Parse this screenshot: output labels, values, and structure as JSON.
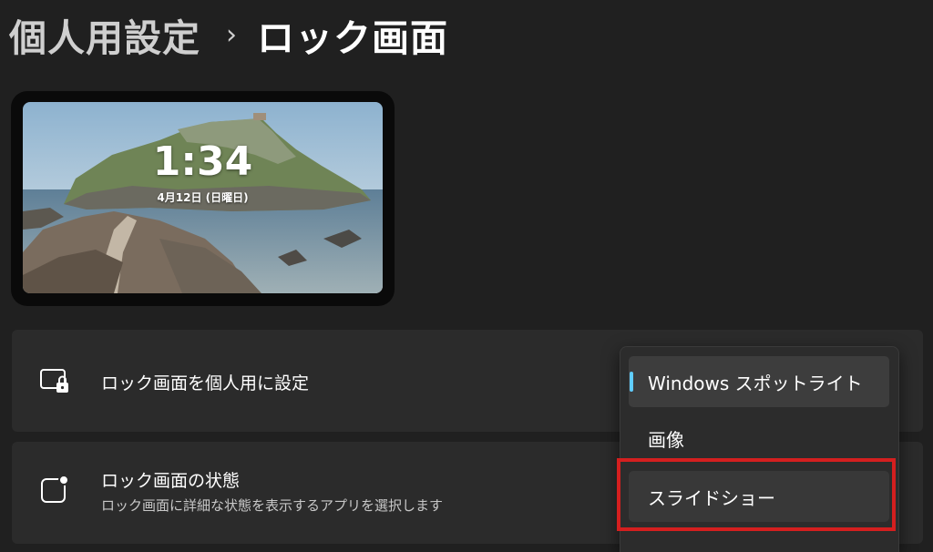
{
  "breadcrumb": {
    "parent": "個人用設定",
    "separator": "›",
    "current": "ロック画面"
  },
  "preview": {
    "time": "1:34",
    "date": "4月12日 (日曜日)"
  },
  "settings": {
    "personalize": {
      "title": "ロック画面を個人用に設定",
      "icon": "lock-screen-icon"
    },
    "status": {
      "title": "ロック画面の状態",
      "subtitle": "ロック画面に詳細な状態を表示するアプリを選択します",
      "icon": "status-icon"
    }
  },
  "dropdown": {
    "options": [
      "Windows スポットライト",
      "画像",
      "スライドショー"
    ],
    "selected": "Windows スポットライト",
    "accent_color": "#60cdff"
  },
  "annotation": {
    "color": "#d41f1f"
  }
}
